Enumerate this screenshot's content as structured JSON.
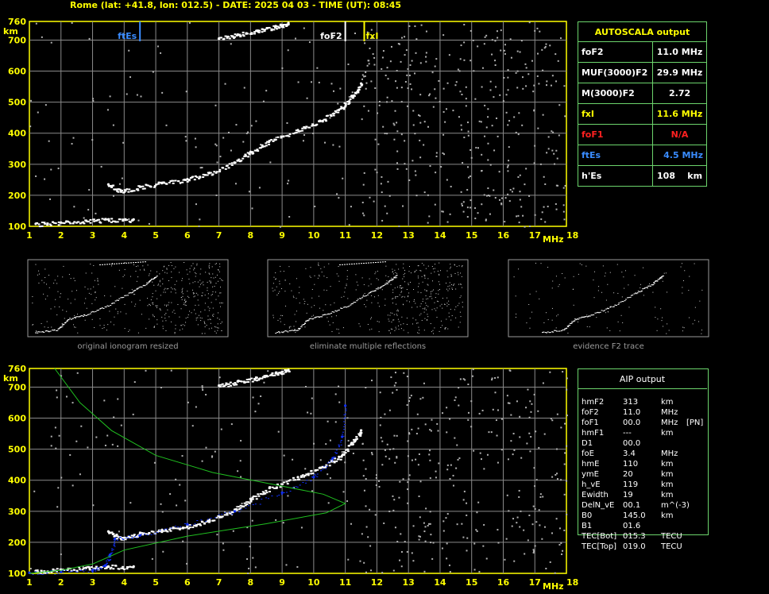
{
  "header": "Rome (lat: +41.8, lon: 012.5) - DATE: 2025 04 03 - TIME (UT): 08:45",
  "colors": {
    "grid": "#8a8a8a",
    "axis": "#ffff00",
    "frame_green": "#6cd46c",
    "fxI": "#ffff00",
    "foF1": "#ff2020",
    "ftEs": "#3a8cff",
    "profile": "#1030ff",
    "model": "#20c020"
  },
  "chart_data": [
    {
      "type": "scatter",
      "title": "",
      "xlabel": "MHz",
      "ylabel": "km",
      "xlim": [
        1,
        18
      ],
      "ylim": [
        100,
        760
      ],
      "xticks": [
        1,
        2,
        3,
        4,
        5,
        6,
        7,
        8,
        9,
        10,
        11,
        12,
        13,
        14,
        15,
        16,
        17,
        18
      ],
      "yticks": [
        100,
        200,
        300,
        400,
        500,
        600,
        700,
        760
      ],
      "grid": true,
      "markers": [
        {
          "label": "ftEs",
          "freq": 4.5,
          "color": "#3a8cff"
        },
        {
          "label": "foF2",
          "freq": 11.0,
          "color": "#ffffff"
        },
        {
          "label": "fxI",
          "freq": 11.6,
          "color": "#ffff00"
        }
      ],
      "series": [
        {
          "values": [
            [
              1.2,
              108
            ],
            [
              2.0,
              112
            ],
            [
              2.8,
              118
            ],
            [
              3.5,
              122
            ],
            [
              4.3,
              122
            ]
          ]
        },
        {
          "values": [
            [
              3.5,
              235
            ],
            [
              3.9,
              212
            ],
            [
              4.5,
              228
            ],
            [
              5.2,
              240
            ],
            [
              6.0,
              252
            ],
            [
              6.7,
              272
            ],
            [
              7.5,
              305
            ],
            [
              8.0,
              340
            ],
            [
              8.6,
              375
            ],
            [
              9.5,
              410
            ],
            [
              10.2,
              440
            ],
            [
              10.8,
              475
            ],
            [
              11.2,
              520
            ],
            [
              11.5,
              560
            ]
          ]
        },
        {
          "values": [
            [
              7.0,
              705
            ],
            [
              7.6,
              718
            ],
            [
              8.2,
              730
            ],
            [
              8.8,
              745
            ],
            [
              9.2,
              755
            ]
          ]
        }
      ]
    },
    {
      "type": "line",
      "title": "",
      "xlabel": "MHz",
      "ylabel": "km",
      "xlim": [
        1,
        18
      ],
      "ylim": [
        100,
        760
      ],
      "xticks": [
        1,
        2,
        3,
        4,
        5,
        6,
        7,
        8,
        9,
        10,
        11,
        12,
        13,
        14,
        15,
        16,
        17,
        18
      ],
      "yticks": [
        100,
        200,
        300,
        400,
        500,
        600,
        700,
        760
      ],
      "grid": true,
      "series": [
        {
          "values": [
            [
              1.2,
              108
            ],
            [
              2.0,
              112
            ],
            [
              2.8,
              118
            ],
            [
              3.5,
              122
            ],
            [
              4.3,
              122
            ]
          ]
        },
        {
          "values": [
            [
              3.5,
              235
            ],
            [
              3.9,
              212
            ],
            [
              4.5,
              228
            ],
            [
              5.2,
              240
            ],
            [
              6.0,
              252
            ],
            [
              6.7,
              272
            ],
            [
              7.5,
              305
            ],
            [
              8.0,
              340
            ],
            [
              8.6,
              375
            ],
            [
              9.5,
              410
            ],
            [
              10.2,
              440
            ],
            [
              10.8,
              475
            ],
            [
              11.2,
              520
            ],
            [
              11.5,
              560
            ]
          ]
        },
        {
          "values": [
            [
              7.0,
              705
            ],
            [
              7.6,
              718
            ],
            [
              8.2,
              730
            ],
            [
              8.8,
              745
            ],
            [
              9.2,
              755
            ]
          ]
        },
        {
          "values": [
            [
              1.0,
              102
            ],
            [
              2.0,
              104
            ],
            [
              3.0,
              110
            ],
            [
              3.4,
              125
            ],
            [
              3.55,
              160
            ],
            [
              3.7,
              210
            ],
            [
              4.5,
              222
            ],
            [
              6.0,
              258
            ],
            [
              7.5,
              300
            ],
            [
              9.0,
              360
            ],
            [
              10.0,
              410
            ],
            [
              10.6,
              470
            ],
            [
              10.9,
              540
            ],
            [
              11.0,
              640
            ]
          ]
        },
        {
          "values": [
            [
              1.8,
              760
            ],
            [
              2.6,
              650
            ],
            [
              3.6,
              560
            ],
            [
              5.0,
              480
            ],
            [
              6.8,
              425
            ],
            [
              8.8,
              385
            ],
            [
              10.3,
              355
            ],
            [
              11.0,
              325
            ],
            [
              10.4,
              295
            ],
            [
              8.5,
              260
            ],
            [
              6.0,
              220
            ],
            [
              4.0,
              175
            ],
            [
              3.0,
              130
            ],
            [
              2.0,
              110
            ],
            [
              1.0,
              100
            ]
          ]
        }
      ]
    }
  ],
  "thumbnails": [
    {
      "caption": "original ionogram resized"
    },
    {
      "caption": "eliminate multiple reflections"
    },
    {
      "caption": "evidence F2 trace"
    }
  ],
  "autoscala": {
    "title": "AUTOSCALA output",
    "rows": [
      {
        "label": "foF2",
        "value": "11.0 MHz",
        "color": "#ffffff"
      },
      {
        "label": "MUF(3000)F2",
        "value": "29.9 MHz",
        "color": "#ffffff"
      },
      {
        "label": "M(3000)F2",
        "value": "2.72",
        "color": "#ffffff"
      },
      {
        "label": "fxI",
        "value": "11.6 MHz",
        "color": "#ffff00"
      },
      {
        "label": "foF1",
        "value": "N/A",
        "color": "#ff2020"
      },
      {
        "label": "ftEs",
        "value": "4.5 MHz",
        "color": "#3a8cff"
      },
      {
        "label": "h'Es",
        "value": "108    km",
        "color": "#ffffff"
      }
    ]
  },
  "aip": {
    "title": "AIP output",
    "rows": [
      {
        "name": "hmF2",
        "value": "313",
        "unit": "km",
        "extra": ""
      },
      {
        "name": "foF2",
        "value": "11.0",
        "unit": "MHz",
        "extra": ""
      },
      {
        "name": "foF1",
        "value": "00.0",
        "unit": "MHz",
        "extra": "[PN]"
      },
      {
        "name": "hmF1",
        "value": "---",
        "unit": "km",
        "extra": ""
      },
      {
        "name": "D1",
        "value": "00.0",
        "unit": "",
        "extra": ""
      },
      {
        "name": "foE",
        "value": "3.4",
        "unit": "MHz",
        "extra": ""
      },
      {
        "name": "hmE",
        "value": "110",
        "unit": "km",
        "extra": ""
      },
      {
        "name": "ymE",
        "value": "20",
        "unit": "km",
        "extra": ""
      },
      {
        "name": "h_vE",
        "value": "119",
        "unit": "km",
        "extra": ""
      },
      {
        "name": "Ewidth",
        "value": "19",
        "unit": "km",
        "extra": ""
      },
      {
        "name": "DelN_vE",
        "value": "00.1",
        "unit": "m^(-3)",
        "extra": ""
      },
      {
        "name": "B0",
        "value": "145.0",
        "unit": "km",
        "extra": ""
      },
      {
        "name": "B1",
        "value": "01.6",
        "unit": "",
        "extra": ""
      },
      {
        "name": "TEC[Bot]",
        "value": "015.3",
        "unit": "TECU",
        "extra": ""
      },
      {
        "name": "TEC[Top]",
        "value": "019.0",
        "unit": "TECU",
        "extra": ""
      }
    ]
  }
}
